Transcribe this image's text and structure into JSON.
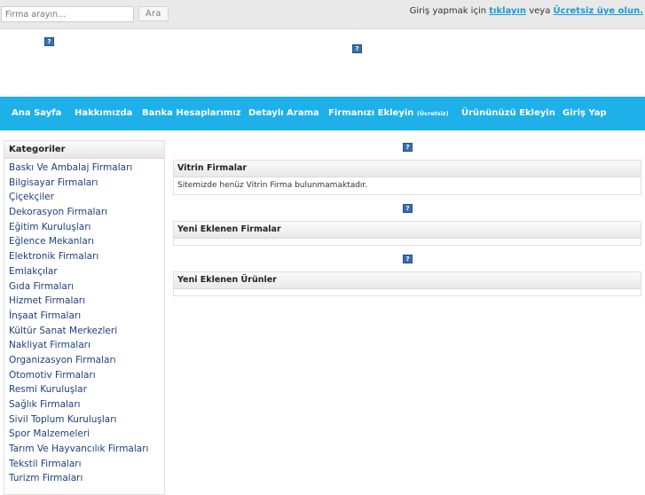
{
  "search": {
    "placeholder": "Firma arayın...",
    "button_label": "Ara"
  },
  "login": {
    "prefix": "Giriş yapmak için ",
    "click_link": "tıklayın",
    "middle": " veya ",
    "register_link": "Ücretsiz üye olun."
  },
  "icon_glyph": "?",
  "nav": {
    "items": [
      "Ana Sayfa",
      "Hakkımızda",
      "Banka Hesaplarımız",
      "Detaylı Arama"
    ],
    "add_company": "Firmanızı Ekleyin",
    "add_company_note": "(Ücretsiz)",
    "add_product": "Ürününüzü Ekleyin",
    "login": "Giriş Yap"
  },
  "sidebar": {
    "title": "Kategoriler",
    "items": [
      "Baskı Ve Ambalaj Firmaları",
      "Bilgisayar Firmaları",
      "Çiçekçiler",
      "Dekorasyon Firmaları",
      "Eğitim Kuruluşları",
      "Eğlence Mekanları",
      "Elektronik Firmaları",
      "Emlakçılar",
      "Gıda Firmaları",
      "Hizmet Firmaları",
      "İnşaat Firmaları",
      "Kültür Sanat Merkezleri",
      "Nakliyat Firmaları",
      "Organizasyon Firmaları",
      "Otomotiv Firmaları",
      "Resmi Kuruluşlar",
      "Sağlık Firmaları",
      "Sivil Toplum Kuruluşları",
      "Spor Malzemeleri",
      "Tarım Ve Hayvancılık Firmaları",
      "Tekstil Firmaları",
      "Turizm Firmaları"
    ]
  },
  "panels": {
    "showcase": {
      "title": "Vitrin Firmalar",
      "body": "Sitemizde henüz Vitrin Firma bulunmamaktadır."
    },
    "new_companies": {
      "title": "Yeni Eklenen Firmalar"
    },
    "new_products": {
      "title": "Yeni Eklenen Ürünler"
    }
  },
  "colors": {
    "nav_bg": "#1eb0e8",
    "link": "#1a9bd7",
    "category_text": "#1e3f7f"
  }
}
